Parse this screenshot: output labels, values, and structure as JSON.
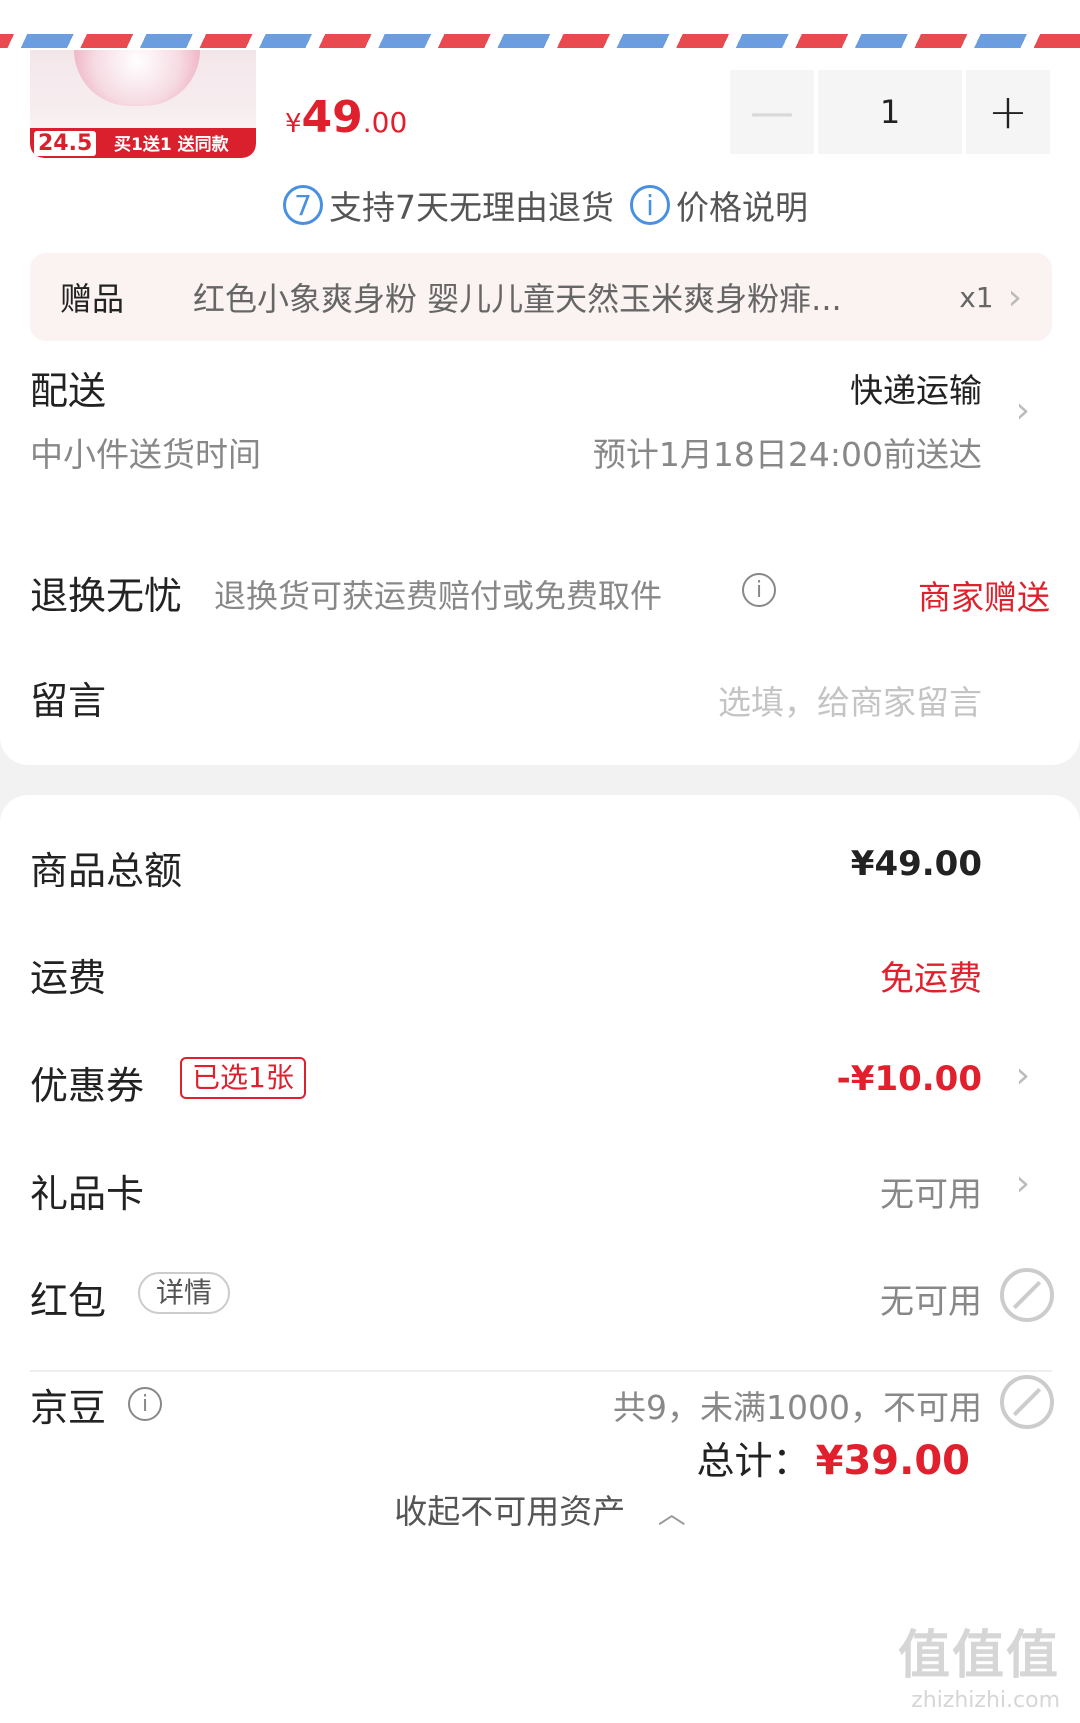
{
  "product": {
    "thumb_price": "24.5",
    "thumb_promo": "买1送1 送同款",
    "price_symbol": "¥",
    "price_int": "49",
    "price_dec": ".00",
    "quantity": "1",
    "minus": "—",
    "plus": "+"
  },
  "support": {
    "return_icon": "7",
    "return_text": "支持7天无理由退货",
    "info_icon": "i",
    "price_text": "价格说明"
  },
  "gift": {
    "label": "赠品",
    "name": "红色小象爽身粉 婴儿儿童天然玉米爽身粉痱...",
    "qty": "x1"
  },
  "delivery": {
    "label": "配送",
    "method": "快递运输",
    "sub_label": "中小件送货时间",
    "eta": "预计1月18日24:00前送达"
  },
  "return_worry": {
    "label": "退换无忧",
    "desc": "退换货可获运费赔付或免费取件",
    "value": "商家赠送"
  },
  "message": {
    "label": "留言",
    "placeholder": "选填，给商家留言"
  },
  "summary": {
    "goods_total_label": "商品总额",
    "goods_total": "¥49.00",
    "shipping_label": "运费",
    "shipping": "免运费",
    "coupon_label": "优惠券",
    "coupon_tag": "已选1张",
    "coupon_value": "-¥10.00",
    "giftcard_label": "礼品卡",
    "giftcard_value": "无可用",
    "redpacket_label": "红包",
    "redpacket_tag": "详情",
    "redpacket_value": "无可用",
    "jingdou_label": "京豆",
    "jingdou_value": "共9，未满1000，不可用",
    "collapse": "收起不可用资产"
  },
  "total": {
    "label": "总计：",
    "value": "¥39.00"
  },
  "watermark": {
    "text_big": "值值值",
    "text_small": "zhizhizhi.com"
  },
  "colors": {
    "accent_red": "#e0202c",
    "info_blue": "#4a90e2"
  }
}
